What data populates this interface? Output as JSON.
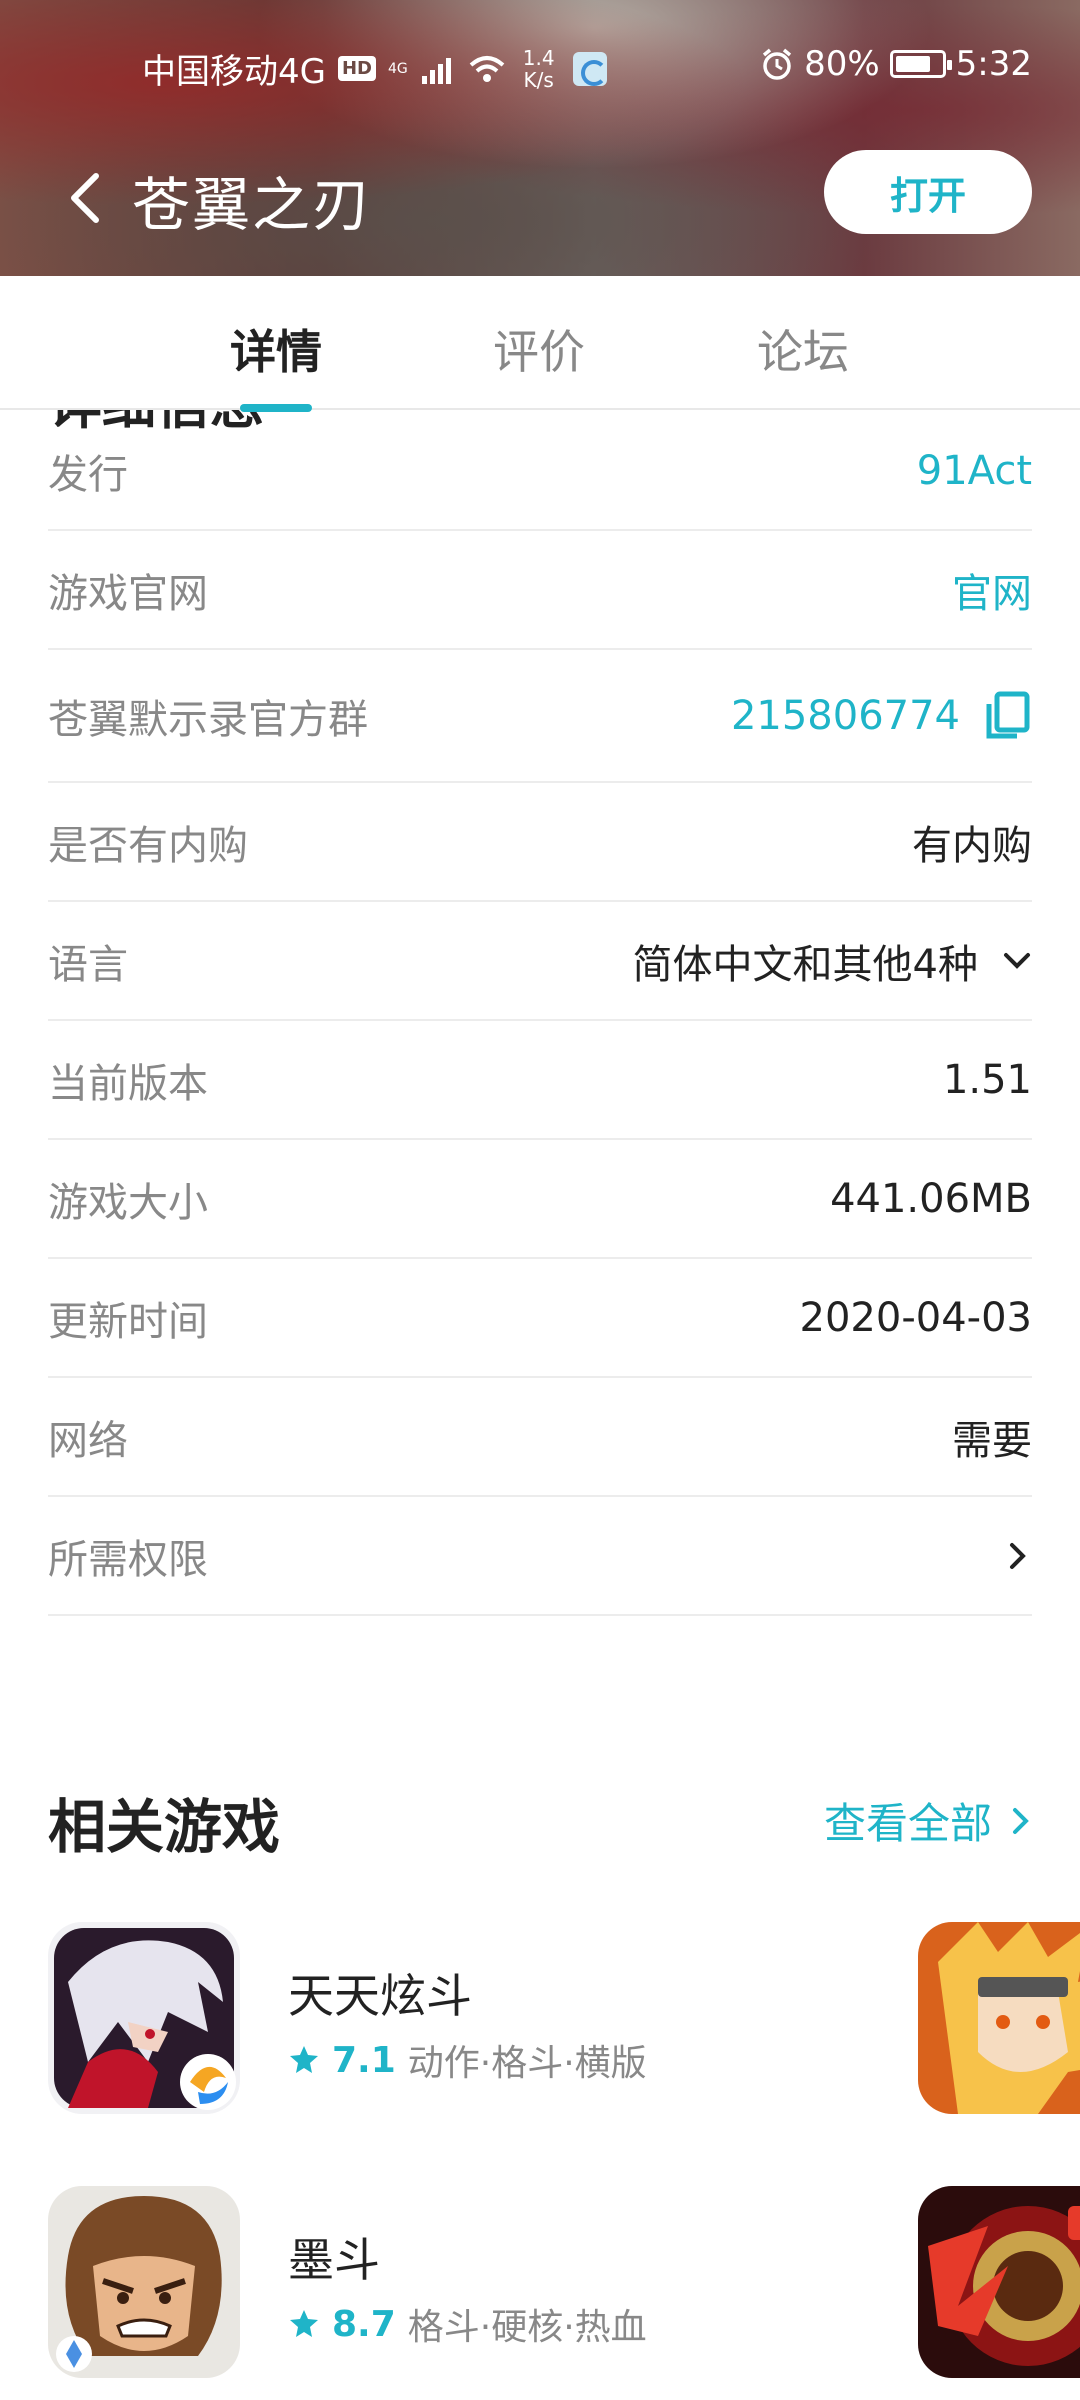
{
  "status_bar": {
    "carrier": "中国移动4G",
    "hd_badge": "HD",
    "network_small": "4G",
    "speed_value": "1.4",
    "speed_unit": "K/s",
    "battery_text": "80%",
    "time": "5:32"
  },
  "header": {
    "title": "苍翼之刃",
    "open_label": "打开"
  },
  "tabs": [
    {
      "label": "详情",
      "active": true
    },
    {
      "label": "评价",
      "active": false
    },
    {
      "label": "论坛",
      "active": false
    }
  ],
  "section_heading": "详细信息",
  "info_rows": [
    {
      "label": "发行",
      "value": "91Act"
    },
    {
      "label": "游戏官网",
      "value": "官网"
    },
    {
      "label": "苍翼默示录官方群",
      "value": "215806774"
    },
    {
      "label": "是否有内购",
      "value": "有内购"
    },
    {
      "label": "语言",
      "value": "简体中文和其他4种"
    },
    {
      "label": "当前版本",
      "value": "1.51"
    },
    {
      "label": "游戏大小",
      "value": "441.06MB"
    },
    {
      "label": "更新时间",
      "value": "2020-04-03"
    },
    {
      "label": "网络",
      "value": "需要"
    },
    {
      "label": "所需权限",
      "value": ""
    }
  ],
  "related": {
    "title": "相关游戏",
    "view_all": "查看全部",
    "games": [
      {
        "name": "天天炫斗",
        "score": "7.1",
        "tags": "动作·格斗·横版"
      },
      {
        "name": "墨斗",
        "score": "8.7",
        "tags": "格斗·硬核·热血"
      }
    ]
  },
  "colors": {
    "accent": "#1fb4c8",
    "label_gray": "#888888",
    "divider": "#ececec"
  }
}
